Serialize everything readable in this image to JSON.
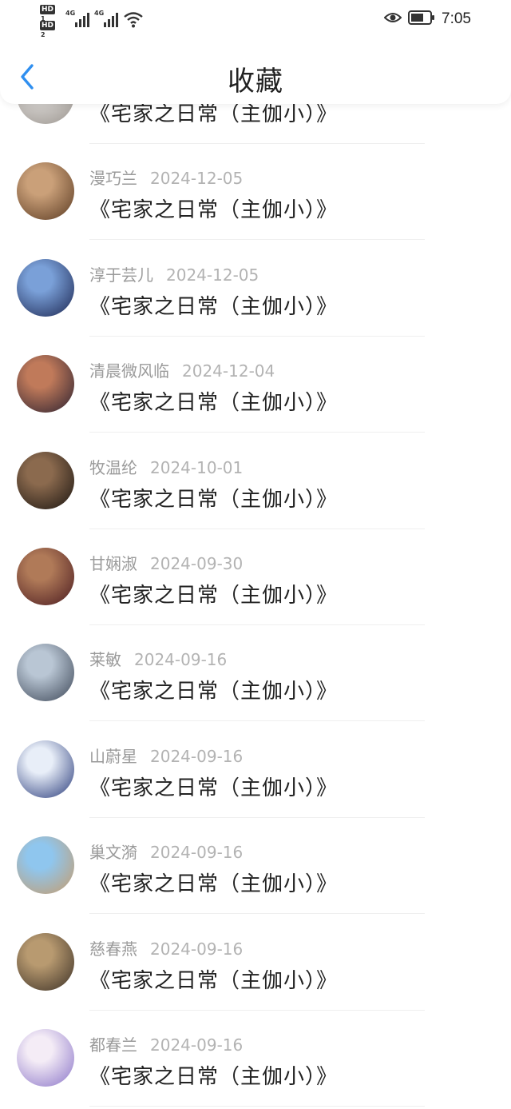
{
  "status_bar": {
    "hd1": "HD",
    "hd1_sub": "1",
    "hd2": "HD",
    "hd2_sub": "2",
    "net1": "4G",
    "net2": "4G",
    "time": "7:05"
  },
  "header": {
    "title": "收藏"
  },
  "colors": {
    "accent": "#2f8ff0",
    "meta": "#9a9a9a",
    "date": "#b3b3b3",
    "text": "#222222"
  },
  "items": [
    {
      "user": "",
      "date": "",
      "book": "《宅家之日常（主伽小）》",
      "avatar_colors": [
        "#d8d5d2",
        "#9a948e"
      ]
    },
    {
      "user": "漫巧兰",
      "date": "2024-12-05",
      "book": "《宅家之日常（主伽小）》",
      "avatar_colors": [
        "#caa079",
        "#5a3a22"
      ]
    },
    {
      "user": "淳于芸儿",
      "date": "2024-12-05",
      "book": "《宅家之日常（主伽小）》",
      "avatar_colors": [
        "#7aa0d8",
        "#1b2550"
      ]
    },
    {
      "user": "清晨微风临",
      "date": "2024-12-04",
      "book": "《宅家之日常（主伽小）》",
      "avatar_colors": [
        "#c07a5a",
        "#2a2030"
      ]
    },
    {
      "user": "牧温纶",
      "date": "2024-10-01",
      "book": "《宅家之日常（主伽小）》",
      "avatar_colors": [
        "#8b6a4e",
        "#1a1410"
      ]
    },
    {
      "user": "甘娴淑",
      "date": "2024-09-30",
      "book": "《宅家之日常（主伽小）》",
      "avatar_colors": [
        "#b07a58",
        "#4a1a20"
      ]
    },
    {
      "user": "莱敏",
      "date": "2024-09-16",
      "book": "《宅家之日常（主伽小）》",
      "avatar_colors": [
        "#b9c6d4",
        "#3c4656"
      ]
    },
    {
      "user": "山蔚星",
      "date": "2024-09-16",
      "book": "《宅家之日常（主伽小）》",
      "avatar_colors": [
        "#e8eef8",
        "#283a7a"
      ]
    },
    {
      "user": "巢文漪",
      "date": "2024-09-16",
      "book": "《宅家之日常（主伽小）》",
      "avatar_colors": [
        "#8fc6ee",
        "#c79b6a"
      ]
    },
    {
      "user": "慈春燕",
      "date": "2024-09-16",
      "book": "《宅家之日常（主伽小）》",
      "avatar_colors": [
        "#b89a70",
        "#3b3026"
      ]
    },
    {
      "user": "都春兰",
      "date": "2024-09-16",
      "book": "《宅家之日常（主伽小）》",
      "avatar_colors": [
        "#f4ecf6",
        "#8a74c8"
      ]
    }
  ]
}
